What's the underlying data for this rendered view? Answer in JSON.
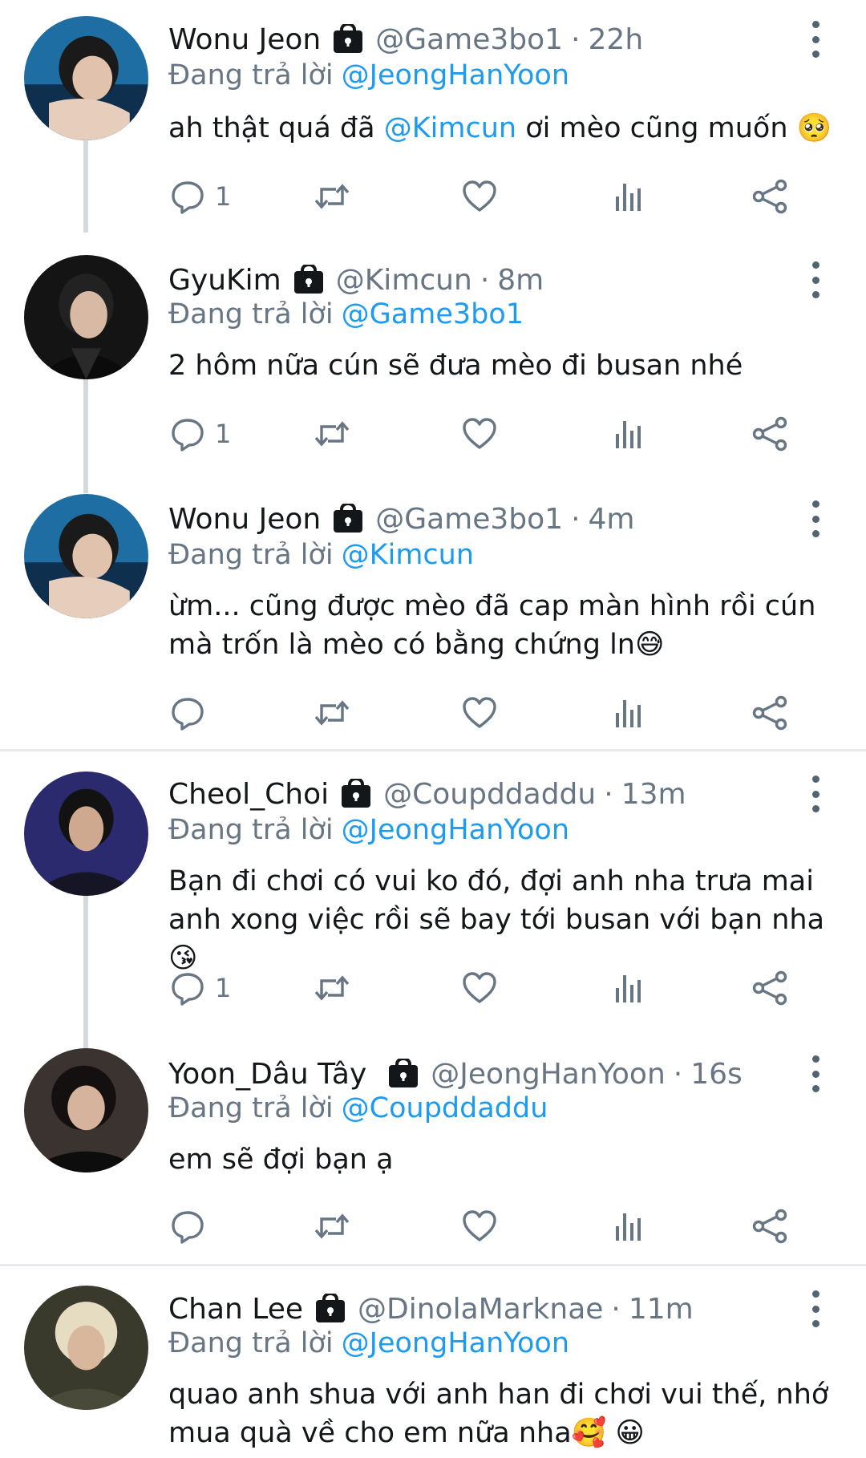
{
  "replying_label": "Đang trả lời",
  "colors": {
    "accent": "#1d9bf0",
    "muted": "#687684",
    "text": "#14171a"
  },
  "icons": {
    "reply": "reply-icon",
    "retweet": "retweet-icon",
    "like": "heart-icon",
    "views": "analytics-icon",
    "share": "share-icon",
    "more": "more-vertical-icon",
    "lock": "lock-icon"
  },
  "posts": [
    {
      "name": "Wonu Jeon",
      "handle": "@Game3bo1",
      "time": "22h",
      "reply_to": "@JeongHanYoon",
      "text_before": "ah thật quá đã ",
      "text_mention": "@Kimcun",
      "text_after": " ơi mèo cũng muốn 🥺",
      "reply_count": "1"
    },
    {
      "name": "GyuKim",
      "handle": "@Kimcun",
      "time": "8m",
      "reply_to": "@Game3bo1",
      "text": "2 hôm nữa cún sẽ đưa mèo đi busan nhé",
      "reply_count": "1"
    },
    {
      "name": "Wonu Jeon",
      "handle": "@Game3bo1",
      "time": "4m",
      "reply_to": "@Kimcun",
      "text": "ừm... cũng được mèo đã cap màn hình rồi cún mà trốn là mèo có bằng chứng ln😅",
      "reply_count": ""
    },
    {
      "name": "Cheol_Choi",
      "handle": "@Coupddaddu",
      "time": "13m",
      "reply_to": "@JeongHanYoon",
      "text": "Bạn đi chơi có vui ko đó, đợi anh nha trưa mai anh xong việc rồi sẽ bay tới busan với bạn nha😘",
      "reply_count": "1"
    },
    {
      "name": "Yoon_Dâu Tây",
      "handle": "@JeongHanYoon",
      "time": "16s",
      "reply_to": "@Coupddaddu",
      "text": "em sẽ đợi bạn ạ",
      "reply_count": ""
    },
    {
      "name": "Chan Lee",
      "handle": "@DinolaMarknae",
      "time": "11m",
      "reply_to": "@JeongHanYoon",
      "text": "quao anh shua với anh han đi chơi vui thế, nhớ mua quà về cho em nữa nha🥰 😀",
      "reply_count": ""
    }
  ]
}
